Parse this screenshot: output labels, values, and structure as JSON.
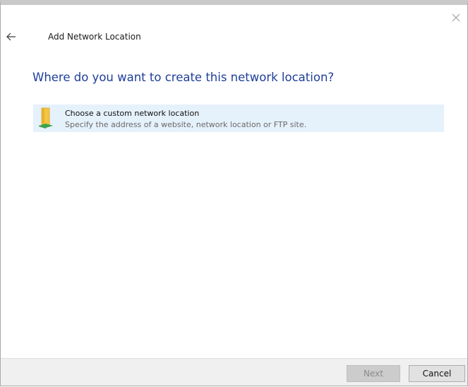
{
  "window": {
    "title": "Add Network Location",
    "close_icon": "close-icon",
    "back_icon": "back-arrow-icon"
  },
  "main": {
    "heading": "Where do you want to create this network location?",
    "options": [
      {
        "icon": "network-folder-icon",
        "title": "Choose a custom network location",
        "description": "Specify the address of a website, network location or FTP site."
      }
    ]
  },
  "footer": {
    "next_label": "Next",
    "cancel_label": "Cancel"
  },
  "colors": {
    "heading": "#1e3e9a",
    "option_highlight": "#e5f1fb"
  }
}
